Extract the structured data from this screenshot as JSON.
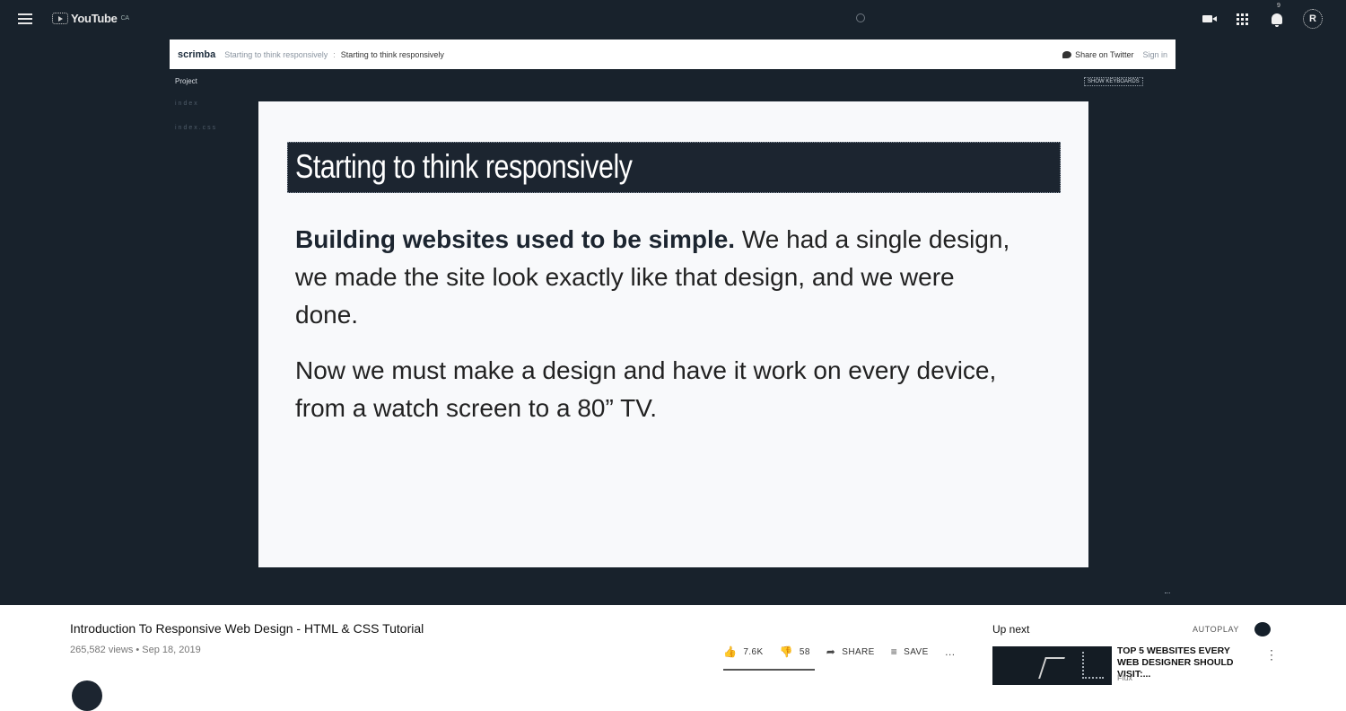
{
  "header": {
    "logo_text": "YouTube",
    "logo_region": "CA",
    "notification_count": "9",
    "avatar_letter": "R"
  },
  "scrimba": {
    "logo": "scrimba",
    "breadcrumb_course": "Starting to think responsively",
    "breadcrumb_sep": ":",
    "breadcrumb_lesson": "Starting to think responsively",
    "share_label": "Share on Twitter",
    "signin_label": "Sign in",
    "project_label": "Project",
    "side_items": [
      "index",
      "index.css"
    ],
    "show_button_label": "SHOW KEYBOARDS"
  },
  "slide": {
    "title": "Starting to think responsively",
    "para1_bold": "Building websites used to be simple.",
    "para1_rest": " We had a single design, we made the site look exactly like that design, and we were done.",
    "para2": "Now we must make a design and have it work on every device, from a watch screen to a 80” TV."
  },
  "video": {
    "title": "Introduction To Responsive Web Design - HTML & CSS Tutorial",
    "meta": "265,582 views • Sep 18, 2019",
    "likes": "7.6K",
    "dislikes": "58",
    "share_label": "SHARE",
    "save_label": "SAVE",
    "more_label": "…"
  },
  "sidebar": {
    "up_next_label": "Up next",
    "autoplay_label": "AUTOPLAY",
    "next_video": {
      "title": "TOP 5 WEBSITES EVERY WEB DESIGNER SHOULD VISIT:...",
      "channel": "Flux"
    }
  },
  "colors": {
    "player_bg": "#18222c",
    "slide_title_bg": "#1c2530",
    "slide_bg": "#f8f9fb"
  }
}
